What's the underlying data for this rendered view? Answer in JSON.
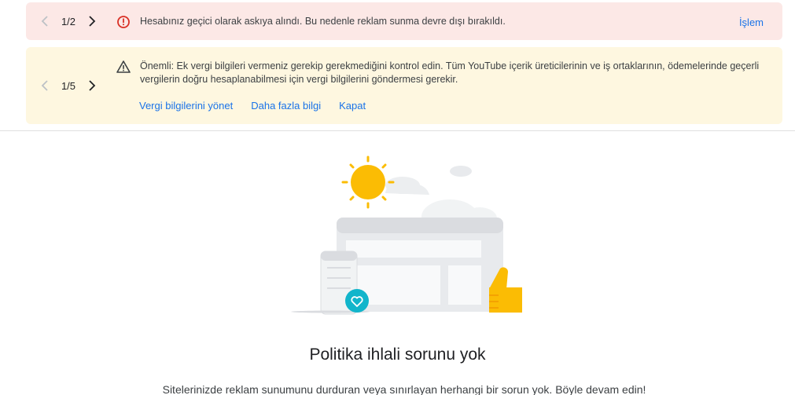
{
  "error_banner": {
    "pager": "1/2",
    "message": "Hesabınız geçici olarak askıya alındı. Bu nedenle reklam sunma devre dışı bırakıldı.",
    "action": "İşlem",
    "icon": "error-circle-icon",
    "color": "#d93025"
  },
  "warning_banner": {
    "pager": "1/5",
    "message": "Önemli: Ek vergi bilgileri vermeniz gerekip gerekmediğini kontrol edin. Tüm YouTube içerik üreticilerinin ve iş ortaklarının, ödemelerinde geçerli vergilerin doğru hesaplanabilmesi için vergi bilgilerini göndermesi gerekir.",
    "icon": "warning-triangle-icon",
    "links": {
      "manage": "Vergi bilgilerini yönet",
      "learn_more": "Daha fazla bilgi",
      "close": "Kapat"
    }
  },
  "main": {
    "headline": "Politika ihlali sorunu yok",
    "subline": "Sitelerinizde reklam sunumunu durduran veya sınırlayan herhangi bir sorun yok. Böyle devam edin!"
  },
  "colors": {
    "link": "#1a73e8",
    "error_bg": "#fce8e6",
    "warning_bg": "#fef7e0",
    "sun": "#fbbc04",
    "accent_teal": "#12b5cb"
  }
}
